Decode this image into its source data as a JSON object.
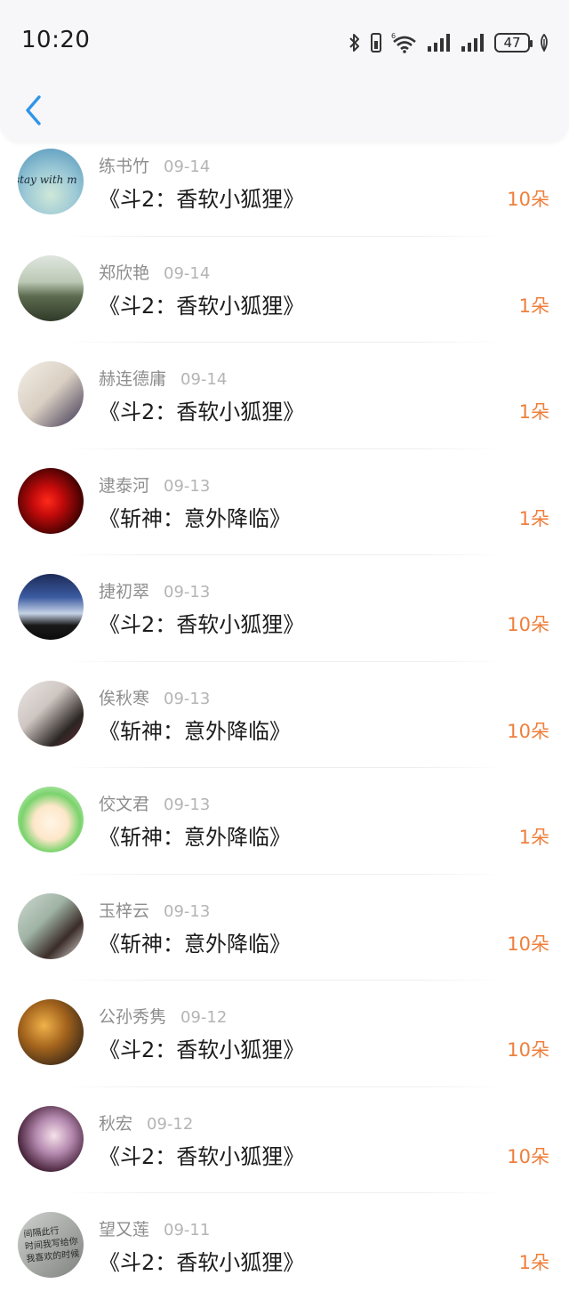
{
  "status_bar": {
    "time": "10:20",
    "battery": "47",
    "icons": [
      "bluetooth-icon",
      "vibrate-icon",
      "wifi-6-icon",
      "signal-icon",
      "signal-icon",
      "battery-icon",
      "leaf-icon"
    ]
  },
  "nav": {
    "back_icon": "chevron-left-icon",
    "accent": "#2f95e8"
  },
  "colors": {
    "amount": "#ef7f3c",
    "name": "#8e8e8e",
    "date": "#b4b4b4",
    "title": "#1c1c1c"
  },
  "items": [
    {
      "name": "练书竹",
      "date": "09-14",
      "title": "《斗2：香软小狐狸》",
      "amount": "10朵",
      "avatar_text": "stay with m"
    },
    {
      "name": "郑欣艳",
      "date": "09-14",
      "title": "《斗2：香软小狐狸》",
      "amount": "1朵"
    },
    {
      "name": "赫连德庸",
      "date": "09-14",
      "title": "《斗2：香软小狐狸》",
      "amount": "1朵"
    },
    {
      "name": "逮泰河",
      "date": "09-13",
      "title": "《斩神：意外降临》",
      "amount": "1朵"
    },
    {
      "name": "捷初翠",
      "date": "09-13",
      "title": "《斗2：香软小狐狸》",
      "amount": "10朵"
    },
    {
      "name": "俟秋寒",
      "date": "09-13",
      "title": "《斩神：意外降临》",
      "amount": "10朵"
    },
    {
      "name": "佼文君",
      "date": "09-13",
      "title": "《斩神：意外降临》",
      "amount": "1朵"
    },
    {
      "name": "玉梓云",
      "date": "09-13",
      "title": "《斩神：意外降临》",
      "amount": "10朵"
    },
    {
      "name": "公孙秀隽",
      "date": "09-12",
      "title": "《斗2：香软小狐狸》",
      "amount": "10朵"
    },
    {
      "name": "秋宏",
      "date": "09-12",
      "title": "《斗2：香软小狐狸》",
      "amount": "10朵"
    },
    {
      "name": "望又莲",
      "date": "09-11",
      "title": "《斗2：香软小狐狸》",
      "amount": "1朵",
      "avatar_text": "间隔此行\n时间我写给你\n我喜欢的时候"
    }
  ]
}
